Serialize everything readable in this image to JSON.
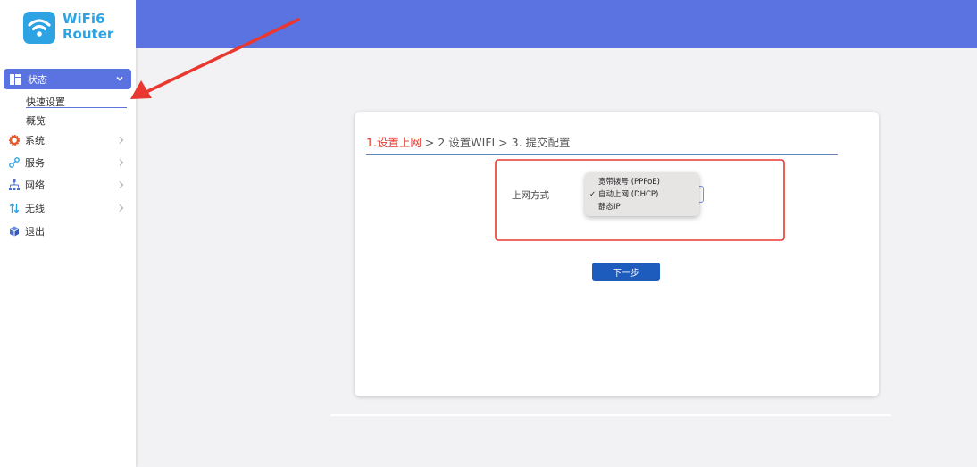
{
  "brand": {
    "line1": "WiFi6",
    "line2": "Router",
    "color": "#2ea3e3"
  },
  "sidebar": {
    "active": {
      "label": "状态",
      "icon": "dashboard-icon"
    },
    "subitems": [
      {
        "label": "快速设置",
        "selected": true
      },
      {
        "label": "概览"
      }
    ],
    "items": [
      {
        "label": "系统",
        "icon": "gear-icon",
        "color": "#e9582b"
      },
      {
        "label": "服务",
        "icon": "link-icon",
        "color": "#2ea3e3"
      },
      {
        "label": "网络",
        "icon": "network-icon",
        "color": "#4a6fd0"
      },
      {
        "label": "无线",
        "icon": "updown-arrows-icon",
        "color": "#2ea3e3"
      },
      {
        "label": "退出",
        "icon": "cube-icon",
        "color": "#4a6fd0"
      }
    ]
  },
  "colors": {
    "accent": "#5b73e0",
    "button": "#1d5bbd",
    "highlight": "#e8382f"
  },
  "wizard": {
    "step1": "1.设置上网",
    "rest": " > 2.设置WIFI > 3. 提交配置"
  },
  "form": {
    "label": "上网方式",
    "options": [
      "宽带拨号 (PPPoE)",
      "自动上网 (DHCP)",
      "静态IP"
    ],
    "selected": "自动上网 (DHCP)",
    "check_mark": "✓"
  },
  "next_button": "下一步"
}
